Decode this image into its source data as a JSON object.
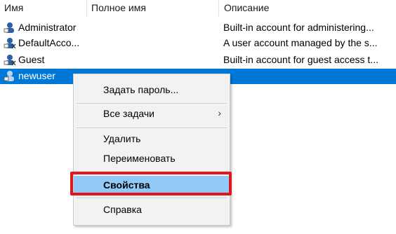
{
  "columns": {
    "name": "Имя",
    "full_name": "Полное имя",
    "description": "Описание"
  },
  "rows": [
    {
      "name": "Administrator",
      "full_name": "",
      "description": "Built-in account for administering..."
    },
    {
      "name": "DefaultAcco...",
      "full_name": "",
      "description": "A user account managed by the s..."
    },
    {
      "name": "Guest",
      "full_name": "",
      "description": "Built-in account for guest access t..."
    },
    {
      "name": "newuser",
      "full_name": "",
      "description": "",
      "selected": true
    }
  ],
  "context_menu": {
    "set_password": "Задать пароль...",
    "all_tasks": "Все задачи",
    "all_tasks_arrow": "›",
    "delete": "Удалить",
    "rename": "Переименовать",
    "properties": "Свойства",
    "help": "Справка"
  },
  "colors": {
    "selection": "#0078d7",
    "menu_highlight": "#91c9f7",
    "annotation_box": "#e0171f"
  },
  "icons": [
    "user-icon"
  ]
}
